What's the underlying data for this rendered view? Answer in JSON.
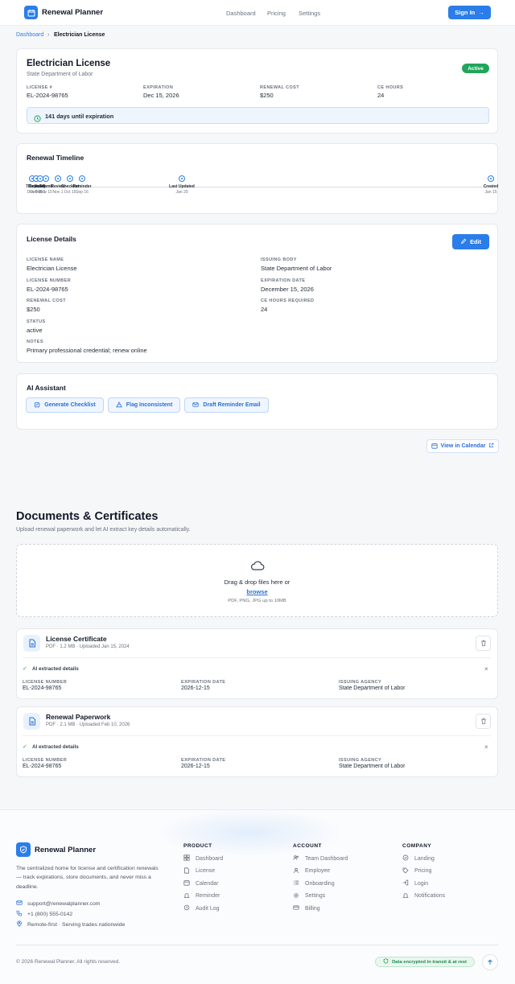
{
  "header": {
    "brand": "Renewal Planner",
    "nav": [
      "Dashboard",
      "Pricing",
      "Settings"
    ],
    "signin": "Sign In"
  },
  "breadcrumb": {
    "home": "Dashboard",
    "current": "Electrician License"
  },
  "license": {
    "title": "Electrician License",
    "issuer": "State Department of Labor",
    "status": "Active",
    "fields": [
      {
        "label": "LICENSE #",
        "value": "EL-2024-98765"
      },
      {
        "label": "EXPIRATION",
        "value": "Dec 15, 2026"
      },
      {
        "label": "RENEWAL COST",
        "value": "$250"
      },
      {
        "label": "CE HOURS",
        "value": "24"
      }
    ],
    "countdown": "141 days until expiration"
  },
  "timeline": {
    "title": "Renewal Timeline",
    "events": [
      {
        "label": "7 Days",
        "date": "Dec 8"
      },
      {
        "label": "Renewal",
        "date": "Dec 15"
      },
      {
        "label": "Notify",
        "date": "Dec 1"
      },
      {
        "label": "Submit",
        "date": "Nov 15"
      },
      {
        "label": "Review",
        "date": "Nov 1"
      },
      {
        "label": "Checklist",
        "date": "Oct 15"
      },
      {
        "label": "Reminder",
        "date": "Sep 16"
      },
      {
        "label": "Last Updated",
        "date": "Jan 20"
      },
      {
        "label": "Created",
        "date": "Jan 15"
      }
    ]
  },
  "details": {
    "title": "License Details",
    "edit": "Edit",
    "left": [
      {
        "label": "LICENSE NAME",
        "value": "Electrician License"
      },
      {
        "label": "LICENSE NUMBER",
        "value": "EL-2024-98765"
      },
      {
        "label": "RENEWAL COST",
        "value": "$250"
      },
      {
        "label": "STATUS",
        "value": "active"
      },
      {
        "label": "NOTES",
        "value": "Primary professional credential; renew online"
      }
    ],
    "right": [
      {
        "label": "ISSUING BODY",
        "value": "State Department of Labor"
      },
      {
        "label": "EXPIRATION DATE",
        "value": "December 15, 2026"
      },
      {
        "label": "CE HOURS REQUIRED",
        "value": "24"
      }
    ]
  },
  "ai": {
    "title": "AI Assistant",
    "buttons": [
      "Generate Checklist",
      "Flag Inconsistent",
      "Draft Reminder Email"
    ]
  },
  "calendar_link": "View in Calendar",
  "documents": {
    "title": "Documents & Certificates",
    "subtitle": "Upload renewal paperwork and let AI extract key details automatically.",
    "drop_text": "Drag & drop files here or",
    "browse": "browse",
    "drop_hint": "PDF, PNG, JPG up to 10MB",
    "files": [
      {
        "name": "License Certificate",
        "meta": "PDF · 1.2 MB · Uploaded Jan 15, 2024",
        "extracted": "AI extracted details",
        "fields": [
          {
            "label": "LICENSE NUMBER",
            "value": "EL-2024-98765"
          },
          {
            "label": "EXPIRATION DATE",
            "value": "2026-12-15"
          },
          {
            "label": "ISSUING AGENCY",
            "value": "State Department of Labor"
          }
        ]
      },
      {
        "name": "Renewal Paperwork",
        "meta": "PDF · 2.1 MB · Uploaded Feb 10, 2026",
        "extracted": "AI extracted details",
        "fields": [
          {
            "label": "LICENSE NUMBER",
            "value": "EL-2024-98765"
          },
          {
            "label": "EXPIRATION DATE",
            "value": "2026-12-15"
          },
          {
            "label": "ISSUING AGENCY",
            "value": "State Department of Labor"
          }
        ]
      }
    ]
  },
  "footer": {
    "brand": "Renewal Planner",
    "tagline": "The centralized home for license and certification renewals — track expirations, store documents, and never miss a deadline.",
    "email": "support@renewalplanner.com",
    "phone": "+1 (800) 555-0142",
    "location": "Remote-first · Serving trades nationwide",
    "product": {
      "title": "PRODUCT",
      "items": [
        "Dashboard",
        "License",
        "Calendar",
        "Reminder",
        "Audit Log"
      ]
    },
    "account": {
      "title": "ACCOUNT",
      "items": [
        "Team Dashboard",
        "Employee",
        "Onboarding",
        "Settings",
        "Billing"
      ]
    },
    "company": {
      "title": "COMPANY",
      "items": [
        "Landing",
        "Pricing",
        "Login",
        "Notifications"
      ]
    },
    "copyright": "© 2026 Renewal Planner. All rights reserved.",
    "security": "Data encrypted in transit & at rest"
  },
  "colors": {
    "primary": "#2b7de9",
    "success": "#22a55b"
  }
}
